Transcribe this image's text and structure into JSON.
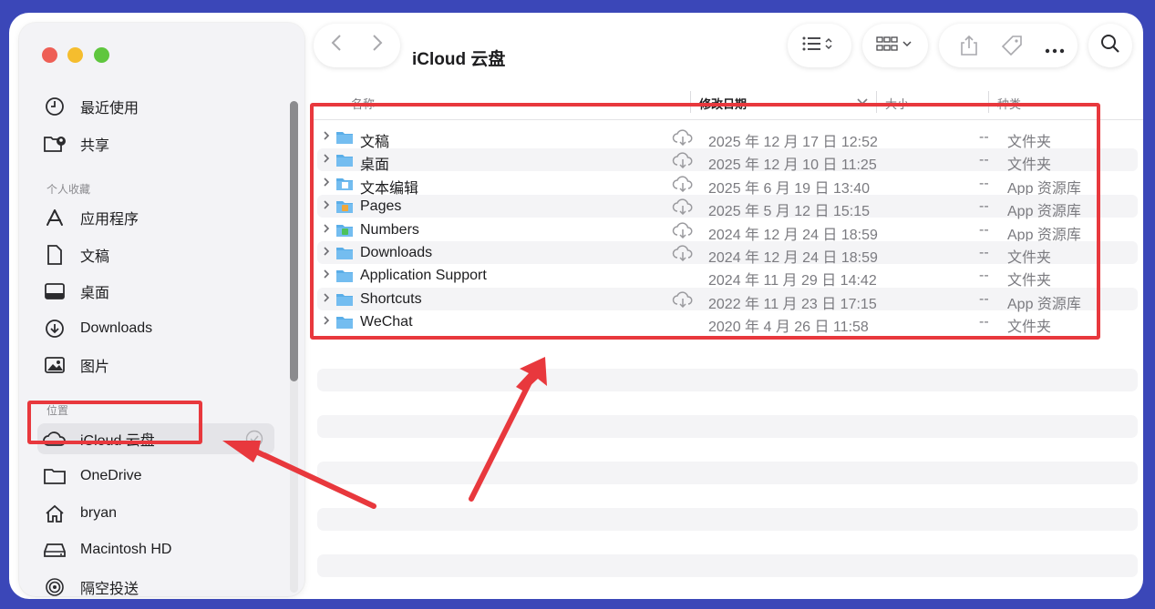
{
  "window": {
    "title": "iCloud 云盘"
  },
  "sidebar": {
    "recents_label": "最近使用",
    "shared_label": "共享",
    "favorites_header": "个人收藏",
    "favorites": [
      {
        "label": "应用程序",
        "icon": "apps-icon"
      },
      {
        "label": "文稿",
        "icon": "document-icon"
      },
      {
        "label": "桌面",
        "icon": "desktop-icon"
      },
      {
        "label": "Downloads",
        "icon": "download-icon"
      },
      {
        "label": "图片",
        "icon": "pictures-icon"
      }
    ],
    "locations_header": "位置",
    "locations": [
      {
        "label": "iCloud 云盘",
        "icon": "cloud-icon",
        "active": true
      },
      {
        "label": "OneDrive",
        "icon": "folder-icon"
      },
      {
        "label": "bryan",
        "icon": "home-icon"
      },
      {
        "label": "Macintosh HD",
        "icon": "drive-icon"
      },
      {
        "label": "隔空投送",
        "icon": "airdrop-icon"
      }
    ]
  },
  "columns": {
    "name": "名称",
    "date": "修改日期",
    "size": "大小",
    "kind": "种类"
  },
  "files": [
    {
      "name": "文稿",
      "cloud": true,
      "date": "2025 年 12 月 17 日 12:52",
      "size": "--",
      "kind": "文件夹",
      "icon": "folder-icon"
    },
    {
      "name": "桌面",
      "cloud": true,
      "date": "2025 年 12 月 10 日 11:25",
      "size": "--",
      "kind": "文件夹",
      "icon": "folder-icon"
    },
    {
      "name": "文本编辑",
      "cloud": true,
      "date": "2025 年 6 月 19 日 13:40",
      "size": "--",
      "kind": "App 资源库",
      "icon": "textedit-folder-icon"
    },
    {
      "name": "Pages",
      "cloud": true,
      "date": "2025 年 5 月 12 日 15:15",
      "size": "--",
      "kind": "App 资源库",
      "icon": "pages-folder-icon"
    },
    {
      "name": "Numbers",
      "cloud": true,
      "date": "2024 年 12 月 24 日 18:59",
      "size": "--",
      "kind": "App 资源库",
      "icon": "numbers-folder-icon"
    },
    {
      "name": "Downloads",
      "cloud": true,
      "date": "2024 年 12 月 24 日 18:59",
      "size": "--",
      "kind": "文件夹",
      "icon": "folder-icon"
    },
    {
      "name": "Application Support",
      "cloud": false,
      "date": "2024 年 11 月 29 日 14:42",
      "size": "--",
      "kind": "文件夹",
      "icon": "folder-icon"
    },
    {
      "name": "Shortcuts",
      "cloud": true,
      "date": "2022 年 11 月 23 日 17:15",
      "size": "--",
      "kind": "App 资源库",
      "icon": "folder-icon"
    },
    {
      "name": "WeChat",
      "cloud": false,
      "date": "2020 年 4 月 26 日 11:58",
      "size": "--",
      "kind": "文件夹",
      "icon": "folder-icon"
    }
  ],
  "colors": {
    "annotation": "#e8383d",
    "background": "#3b47b8",
    "folder": "#5aaee8"
  }
}
